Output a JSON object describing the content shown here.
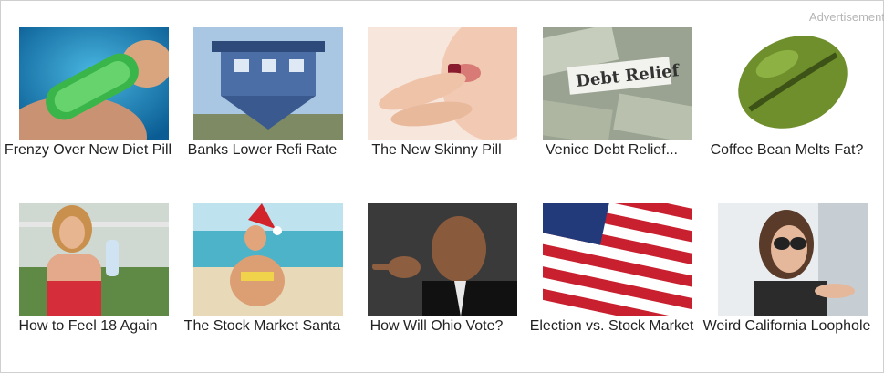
{
  "ad": {
    "label": "Advertisement"
  },
  "tiles": [
    {
      "caption": "Frenzy Over New Diet Pill",
      "image": "green-diet-pill-photo"
    },
    {
      "caption": "Banks Lower Refi Rate",
      "image": "upside-down-house-photo"
    },
    {
      "caption": "The New Skinny Pill",
      "image": "pill-at-lips-photo"
    },
    {
      "caption": "Venice Debt Relief...",
      "image": "debt-relief-dollars-photo"
    },
    {
      "caption": "Coffee Bean Melts Fat?",
      "image": "green-coffee-bean-photo"
    },
    {
      "caption": "How to Feel 18 Again",
      "image": "woman-with-water-bottle-photo"
    },
    {
      "caption": "The Stock Market Santa",
      "image": "santa-hat-beach-photo"
    },
    {
      "caption": "How Will Ohio Vote?",
      "image": "politician-pointing-photo"
    },
    {
      "caption": "Election vs. Stock Market",
      "image": "us-flag-photo"
    },
    {
      "caption": "Weird California Loophole",
      "image": "woman-in-car-sunglasses-photo"
    }
  ],
  "colors": {
    "border": "#cfcfcf",
    "label": "#b5b5b5",
    "text": "#222222"
  }
}
